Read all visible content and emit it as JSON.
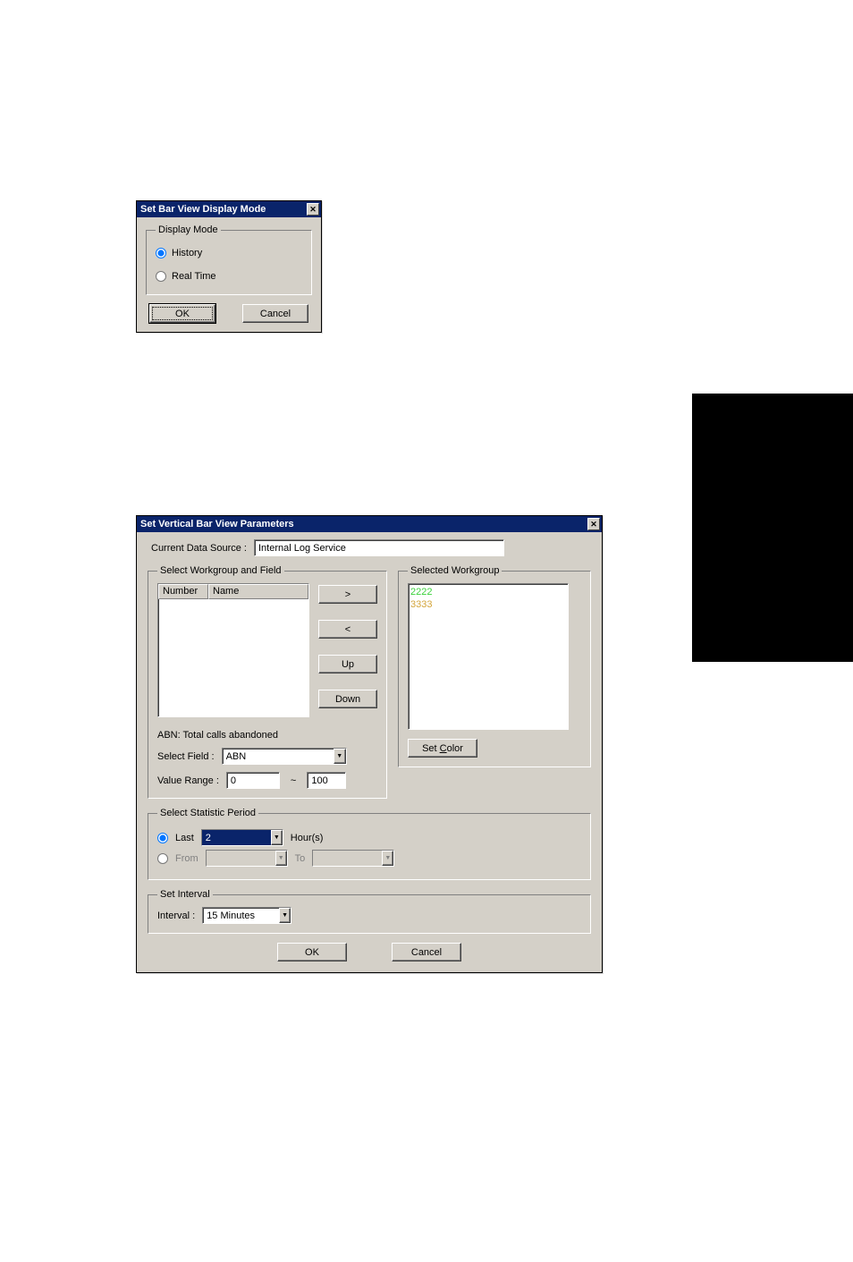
{
  "dialog1": {
    "title": "Set Bar View Display Mode",
    "group_legend": "Display Mode",
    "radio_history": "History",
    "radio_realtime": "Real Time",
    "ok": "OK",
    "cancel": "Cancel"
  },
  "dialog2": {
    "title": "Set Vertical Bar View Parameters",
    "data_source_label": "Current Data Source :",
    "data_source_value": "Internal Log Service",
    "select_wg_legend": "Select Workgroup and Field",
    "col_number": "Number",
    "col_name": "Name",
    "btn_right": ">",
    "btn_left": "<",
    "btn_up": "Up",
    "btn_down": "Down",
    "abn_desc": "ABN: Total calls abandoned",
    "select_field_label": "Select Field :",
    "select_field_value": "ABN",
    "value_range_label": "Value Range :",
    "value_range_low": "0",
    "value_range_sep": "~",
    "value_range_high": "100",
    "selected_wg_legend": "Selected Workgroup",
    "selected_items": [
      "2222",
      "3333"
    ],
    "set_color_prefix": "Set ",
    "set_color_mnemonic": "C",
    "set_color_suffix": "olor",
    "stat_period_legend": "Select Statistic Period",
    "radio_last": "Last",
    "last_value": "2",
    "hours_label": "Hour(s)",
    "radio_from": "From",
    "to_label": "To",
    "interval_legend": "Set Interval",
    "interval_label": "Interval :",
    "interval_value": "15 Minutes",
    "ok": "OK",
    "cancel": "Cancel"
  }
}
